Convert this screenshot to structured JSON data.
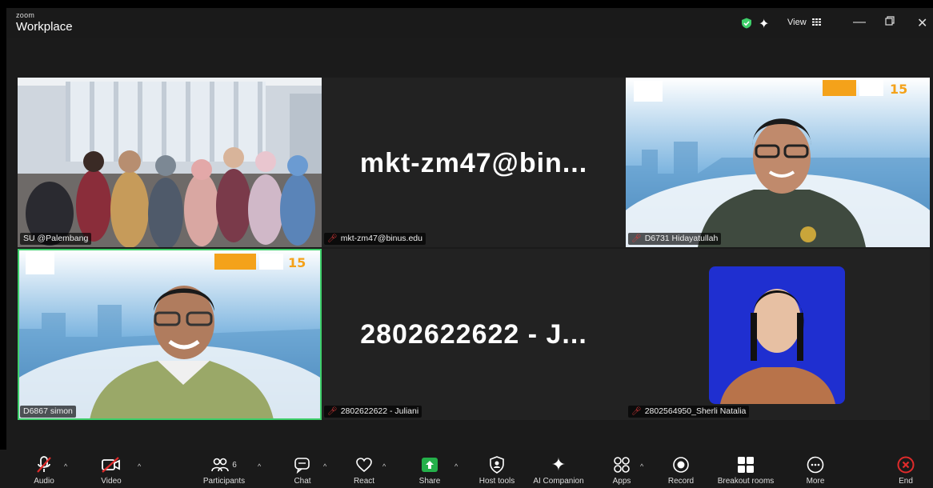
{
  "app": {
    "brand_small": "zoom",
    "brand_big": "Workplace",
    "view_label": "View"
  },
  "tiles": [
    {
      "name": "SU @Palembang",
      "muted": false,
      "kind": "video"
    },
    {
      "name": "mkt-zm47@binus.edu",
      "muted": true,
      "kind": "avatar",
      "display": "mkt-zm47@bin..."
    },
    {
      "name": "D6731 Hidayatullah",
      "muted": true,
      "kind": "video"
    },
    {
      "name": "D6867 simon",
      "muted": false,
      "kind": "video",
      "active": true
    },
    {
      "name": "2802622622 - Juliani",
      "muted": true,
      "kind": "avatar",
      "display": "2802622622 - J..."
    },
    {
      "name": "2802564950_Sherli Natalia",
      "muted": true,
      "kind": "video"
    }
  ],
  "toolbar": {
    "participants_count": "6",
    "labels": {
      "audio": "Audio",
      "video": "Video",
      "participants": "Participants",
      "chat": "Chat",
      "react": "React",
      "share": "Share",
      "host_tools": "Host tools",
      "ai_companion": "AI Companion",
      "apps": "Apps",
      "record": "Record",
      "breakout": "Breakout rooms",
      "more": "More",
      "end": "End"
    }
  },
  "colors": {
    "active_speaker": "#3ecf6a",
    "share_green": "#24b04a",
    "end_red": "#e02b2b",
    "muted_red": "#e03b3b"
  }
}
